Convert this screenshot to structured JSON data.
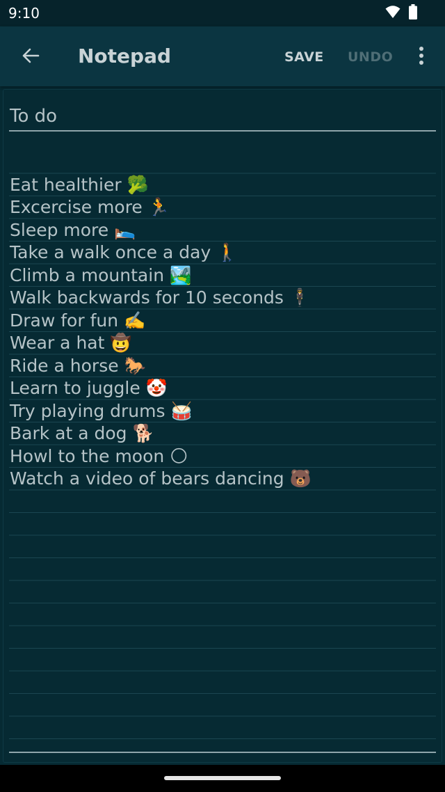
{
  "status_bar": {
    "time": "9:10",
    "icons": [
      "wifi-icon",
      "battery-icon"
    ]
  },
  "app_bar": {
    "title": "Notepad",
    "save_label": "SAVE",
    "undo_label": "UNDO",
    "icons": [
      "back-arrow-icon",
      "overflow-menu-icon"
    ]
  },
  "note": {
    "title": "To do",
    "lines": [
      "",
      "Eat healthier 🥦",
      "Excercise more 🏃",
      "Sleep more 🛌",
      "Take a walk once a day 🚶",
      "Climb a mountain 🏞️",
      "Walk backwards for 10 seconds 🕴️",
      "Draw for fun ✍️",
      "Wear a hat 🤠",
      "Ride a horse 🐎",
      "Learn to juggle 🤡",
      "Try playing drums 🥁",
      "Bark at a dog 🐕",
      "Howl to the moon 🌕",
      "Watch a video of bears dancing 🐻"
    ]
  },
  "colors": {
    "background": "#062a33",
    "app_bar": "#0b3541",
    "text": "#b5c3c7",
    "ruled_line": "#1b4651",
    "disabled_action": "#4f6e76"
  }
}
